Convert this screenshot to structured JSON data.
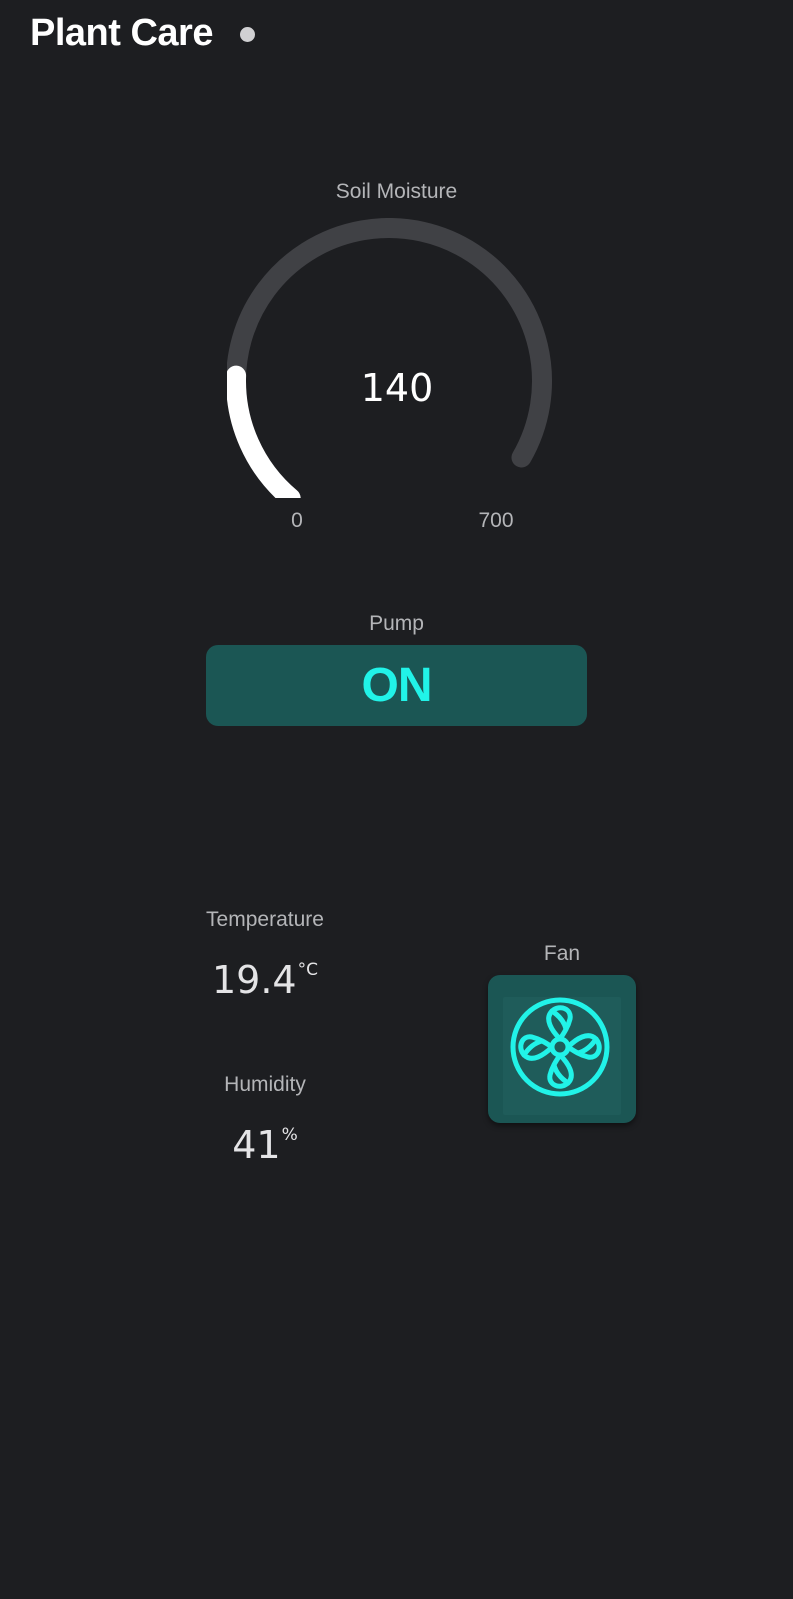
{
  "header": {
    "title": "Plant Care"
  },
  "soil_moisture": {
    "label": "Soil Moisture",
    "value": "140",
    "min": "0",
    "max": "700",
    "level": 0.2
  },
  "pump": {
    "label": "Pump",
    "state": "ON"
  },
  "temperature": {
    "label": "Temperature",
    "value": "19.4",
    "unit": "°C"
  },
  "humidity": {
    "label": "Humidity",
    "value": "41",
    "unit": "%"
  },
  "fan": {
    "label": "Fan",
    "icon": "fan-icon"
  },
  "colors": {
    "background": "#1d1e21",
    "accent": "#21f3e8",
    "button_bg": "#1b5654",
    "gauge_track": "#404145",
    "gauge_fill": "#ffffff",
    "label": "#b4b5b8"
  }
}
